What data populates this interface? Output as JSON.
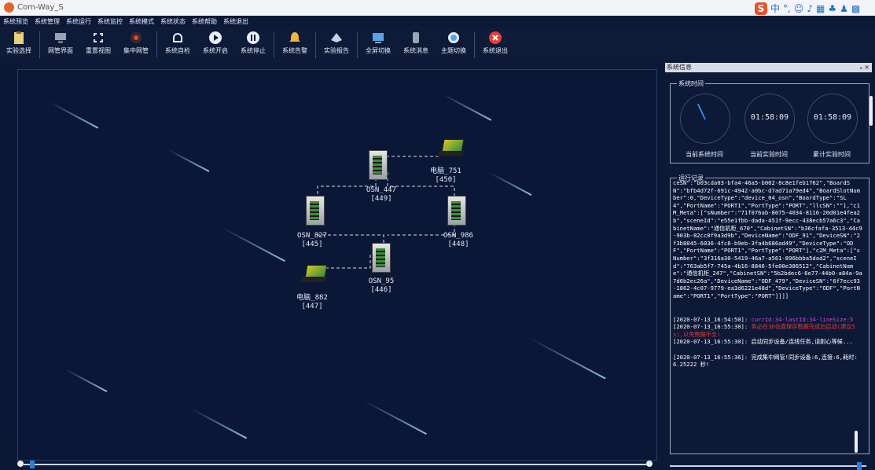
{
  "window": {
    "title": "Com-Way_S"
  },
  "menu": [
    "系统预览",
    "系统管理",
    "系统运行",
    "系统监控",
    "系统模式",
    "系统状态",
    "系统帮助",
    "系统退出"
  ],
  "toolbar": [
    {
      "label": "实验选择",
      "icon": "clipboard-icon",
      "color": "#e7d27a"
    },
    {
      "label": "网管界面",
      "icon": "monitor-icon",
      "color": "#9aa3b3"
    },
    {
      "label": "重置视图",
      "icon": "reset-view-icon",
      "color": "#d8e0ee"
    },
    {
      "label": "集中网管",
      "icon": "central-nms-icon",
      "color": "#e24a2e"
    },
    {
      "label": "系统自检",
      "icon": "self-check-icon",
      "color": "#e6eef8"
    },
    {
      "label": "系统开启",
      "icon": "play-icon",
      "color": "#e6eef8"
    },
    {
      "label": "系统停止",
      "icon": "pause-icon",
      "color": "#e6eef8"
    },
    {
      "label": "系统告警",
      "icon": "bell-icon",
      "color": "#f1b43c"
    },
    {
      "label": "实验报告",
      "icon": "report-icon",
      "color": "#c8d2e0"
    },
    {
      "label": "全屏切换",
      "icon": "fullscreen-icon",
      "color": "#5aa2e8"
    },
    {
      "label": "系统消息",
      "icon": "message-icon",
      "color": "#9aa3b3"
    },
    {
      "label": "主题切换",
      "icon": "theme-icon",
      "color": "#e6eef8"
    },
    {
      "label": "系统退出",
      "icon": "exit-icon",
      "color": "#e2413a"
    }
  ],
  "topology": {
    "nodes": [
      {
        "name": "OSN_447",
        "id": "[449]",
        "type": "cabinet"
      },
      {
        "name": "电脑_751",
        "id": "[450]",
        "type": "laptop"
      },
      {
        "name": "OSN_827",
        "id": "[445]",
        "type": "cabinet"
      },
      {
        "name": "OSN_986",
        "id": "[448]",
        "type": "cabinet"
      },
      {
        "name": "OSN_95",
        "id": "[446]",
        "type": "cabinet"
      },
      {
        "name": "电脑_882",
        "id": "[447]",
        "type": "laptop"
      }
    ]
  },
  "panel": {
    "title": "系统信息",
    "controls": "ₐ ×",
    "time_group": "系统时间",
    "clocks": [
      {
        "label": "当前系统时间",
        "value": ""
      },
      {
        "label": "当前实验时间",
        "value": "01:58:09"
      },
      {
        "label": "累计实验时间",
        "value": "01:58:09"
      }
    ],
    "log_group": "运行记录",
    "log_json": "ceSN\":\"b03cda03-bfa4-46a5-b002-8c8e1feb1762\",\"BoardSN\":\"bfb4d72f-691c-4942-a0bc-d7ad71a79ed4\",\"BoardSlotNumber\":0,\"DeviceType\":\"device_04_osn\",\"BoardType\":\"SL4\",\"PortName\":\"PORT1\",\"PortType\":\"PORT\",\"llcSN\":\"\"],\"c1M_Meta\":[\"sNumber\":\"71f076ab-8075-4034-8116-20d01e4fea2b\",\"sceneId\":\"e55e1fbb-dada-451f-9ecc-438ecb57a6c3\",\"CabinetName\":\"通信机柜_670\",\"CabinetSN\":\"b36cfafa-3513-44c9-903b-82cc0f9a3d9b\",\"DeviceName\":\"ODF_91\",\"DeviceSN\":\"2f3b8845-6036-4fc8-b9eb-3fa4b686ad49\",\"DeviceType\":\"ODF\",\"PortName\":\"PORT1\",\"PortType\":\"PORT\"],\"c2M_Meta\":[\"sNumber\":\"3f316a30-5419-46a7-a561-896bbba5dad2\",\"sceneId\":\"763ab5f7-745a-4b16-8846-5fe00e386512\",\"CabinetName\":\"通信机柜_247\",\"CabinetSN\":\"5b2bdec6-6e77-44b0-a84a-9a7d6b2ec26a\",\"DeviceName\":\"ODF_479\",\"DeviceSN\":\"6f7ecc93-1862-4c07-9779-ea3d6221e48d\",\"DeviceType\":\"ODF\",\"PortName\":\"PORT1\",\"PortType\":\"PORT\"]]]]",
    "log_entries": [
      {
        "time": "[2020-07-13_16:54:50]:",
        "text": "currId:34-lastId:34-lineSize:5",
        "style": "mag"
      },
      {
        "time": "[2020-07-13_16:55:30]:",
        "text": "务必在3D仿真保存数据完成后启动(建议5s),以免数据不全!",
        "style": "red"
      },
      {
        "time": "[2020-07-13_16:55:30]:",
        "text": "启动同步设备/连线任务,请耐心等候...",
        "style": "plain"
      },
      {
        "time": "[2020-07-13_16:55:36]:",
        "text": "完成集中网管!同步设备:6,连接:6,耗时:6.25222 秒!",
        "style": "plain"
      }
    ]
  }
}
